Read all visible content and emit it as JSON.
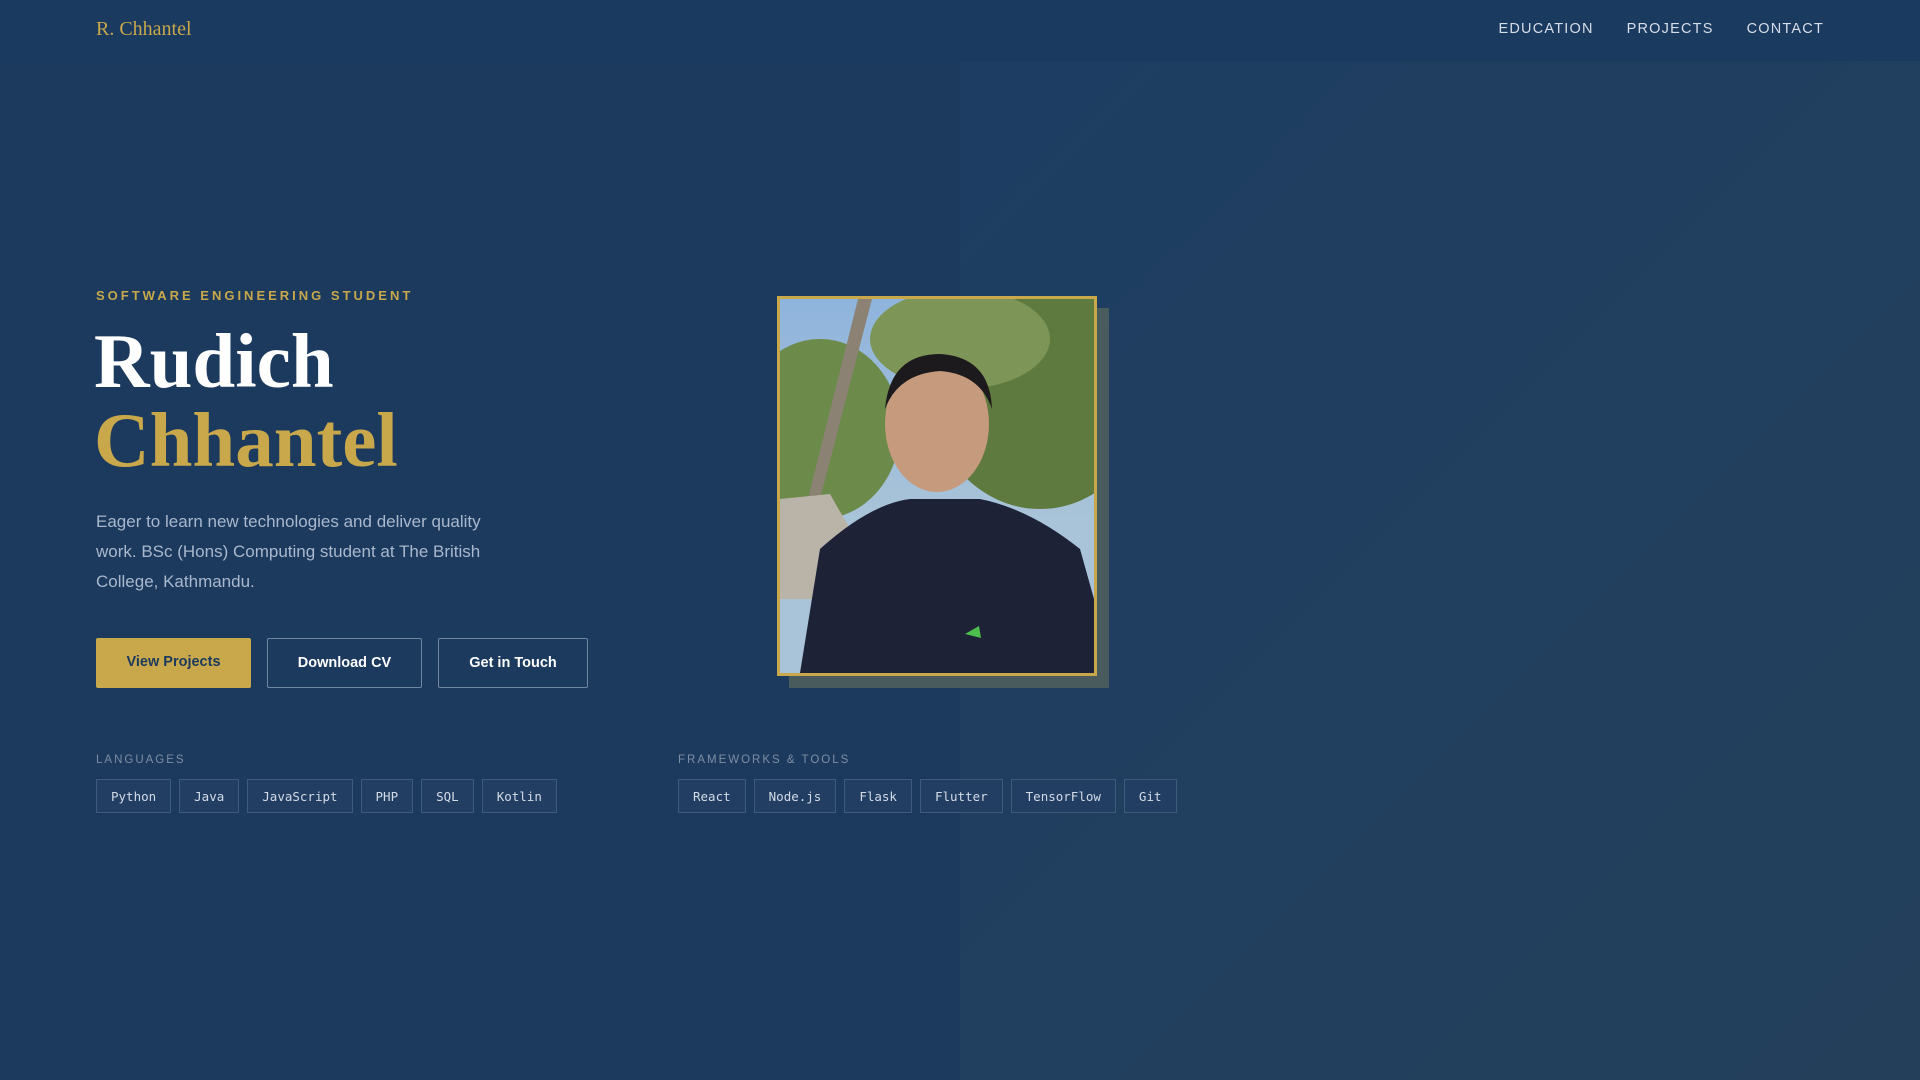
{
  "nav": {
    "brand": "R. Chhantel",
    "links": [
      "EDUCATION",
      "PROJECTS",
      "CONTACT"
    ]
  },
  "hero": {
    "eyebrow": "SOFTWARE ENGINEERING STUDENT",
    "first_name": "Rudich",
    "last_name": "Chhantel",
    "description": "Eager to learn new technologies and deliver quality work. BSc (Hons) Computing student at The British College, Kathmandu.",
    "buttons": {
      "view_projects": "View Projects",
      "download_cv": "Download CV",
      "get_in_touch": "Get in Touch"
    }
  },
  "skills": {
    "languages": {
      "label": "LANGUAGES",
      "items": [
        "Python",
        "Java",
        "JavaScript",
        "PHP",
        "SQL",
        "Kotlin"
      ]
    },
    "frameworks": {
      "label": "FRAMEWORKS & TOOLS",
      "items": [
        "React",
        "Node.js",
        "Flask",
        "Flutter",
        "TensorFlow",
        "Git"
      ]
    }
  },
  "colors": {
    "background": "#1b3a5e",
    "accent": "#c8a84b"
  }
}
